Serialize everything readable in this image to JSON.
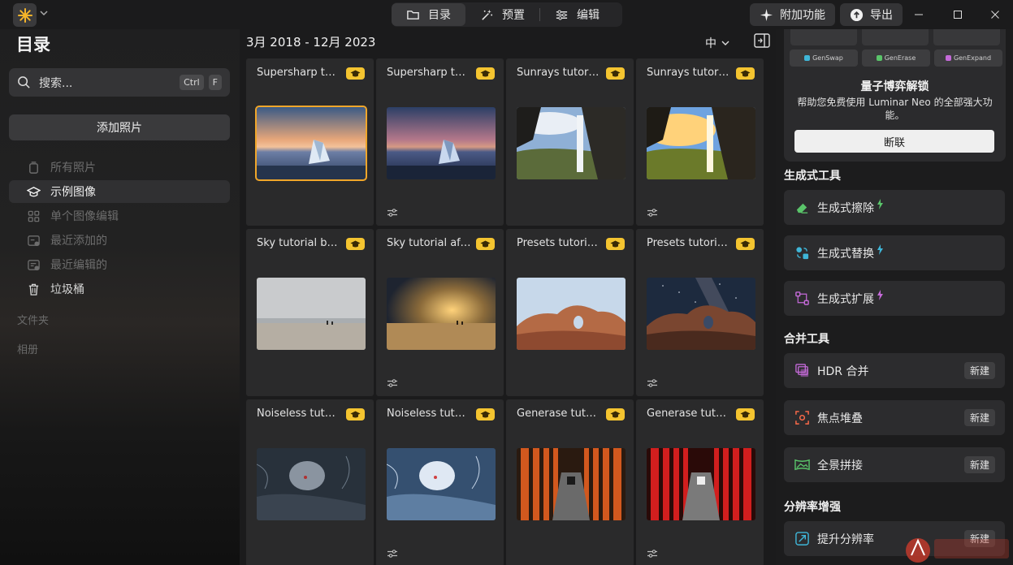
{
  "topbar": {
    "tabs": [
      {
        "label": "目录",
        "icon": "folder-icon",
        "active": true
      },
      {
        "label": "预置",
        "icon": "magic-wand-icon",
        "active": false
      },
      {
        "label": "编辑",
        "icon": "sliders-icon",
        "active": false
      }
    ],
    "extras_label": "附加功能",
    "export_label": "导出"
  },
  "sidebar": {
    "title": "目录",
    "search_placeholder": "搜索...",
    "shortcut_keys": [
      "Ctrl",
      "F"
    ],
    "add_photos_label": "添加照片",
    "items": [
      {
        "label": "所有照片",
        "icon": "photos-stack-icon",
        "state": "disabled"
      },
      {
        "label": "示例图像",
        "icon": "graduation-cap-icon",
        "state": "active"
      },
      {
        "label": "单个图像编辑",
        "icon": "grid-icon",
        "state": "disabled"
      },
      {
        "label": "最近添加的",
        "icon": "recently-added-icon",
        "state": "disabled"
      },
      {
        "label": "最近编辑的",
        "icon": "recently-edited-icon",
        "state": "disabled"
      },
      {
        "label": "垃圾桶",
        "icon": "trash-icon",
        "state": "normal"
      }
    ],
    "sections": [
      "文件夹",
      "相册"
    ]
  },
  "gallery": {
    "date_range": "3月 2018 - 12月 2023",
    "thumb_size": "中",
    "cards": [
      {
        "name": "Supersharp tutorial before",
        "scene": "ice-sunset",
        "selected": true,
        "has_adjust": false
      },
      {
        "name": "Supersharp tutorial after",
        "scene": "ice-sunset-dark",
        "selected": false,
        "has_adjust": true
      },
      {
        "name": "Sunrays tutorial before",
        "scene": "waterfall",
        "selected": false,
        "has_adjust": false
      },
      {
        "name": "Sunrays tutorial after",
        "scene": "waterfall-warm",
        "selected": false,
        "has_adjust": true
      },
      {
        "name": "Sky tutorial before",
        "scene": "beach-grey",
        "selected": false,
        "has_adjust": false
      },
      {
        "name": "Sky tutorial after",
        "scene": "beach-golden",
        "selected": false,
        "has_adjust": true
      },
      {
        "name": "Presets tutorial before",
        "scene": "arch-day",
        "selected": false,
        "has_adjust": false
      },
      {
        "name": "Presets tutorial after",
        "scene": "arch-night",
        "selected": false,
        "has_adjust": true
      },
      {
        "name": "Noiseless tutorial before",
        "scene": "ice-cave-dark",
        "selected": false,
        "has_adjust": false
      },
      {
        "name": "Noiseless tutorial after",
        "scene": "ice-cave-bright",
        "selected": false,
        "has_adjust": true
      },
      {
        "name": "Generase tutorial before",
        "scene": "torii-orange",
        "selected": false,
        "has_adjust": false
      },
      {
        "name": "Generase tutorial after",
        "scene": "torii-red",
        "selected": false,
        "has_adjust": true
      }
    ]
  },
  "right_panel": {
    "chips": [
      {
        "label": "GenSwap",
        "color": "#3fb6d8"
      },
      {
        "label": "GenErase",
        "color": "#5ac46a"
      },
      {
        "label": "GenExpand",
        "color": "#c46ad8"
      }
    ],
    "promo_title": "量子博弈解锁",
    "promo_desc": "帮助您免费使用 Luminar Neo 的全部强大功能。",
    "promo_button": "断联",
    "generative_heading": "生成式工具",
    "generative_tools": [
      {
        "label": "生成式擦除",
        "icon": "eraser-icon",
        "color": "#5ac46a"
      },
      {
        "label": "生成式替换",
        "icon": "swap-icon",
        "color": "#3fb6d8"
      },
      {
        "label": "生成式扩展",
        "icon": "expand-icon",
        "color": "#c46ad8"
      }
    ],
    "merge_heading": "合并工具",
    "merge_tools": [
      {
        "label": "HDR 合并",
        "icon": "hdr-layers-icon",
        "color": "#c46ad8",
        "badge": "新建"
      },
      {
        "label": "焦点堆叠",
        "icon": "focus-stack-icon",
        "color": "#ff6b4a",
        "badge": "新建"
      },
      {
        "label": "全景拼接",
        "icon": "panorama-icon",
        "color": "#5ac46a",
        "badge": "新建"
      }
    ],
    "resolution_heading": "分辨率增强",
    "resolution_tools": [
      {
        "label": "提升分辨率",
        "icon": "upscale-icon",
        "color": "#3fb6d8",
        "badge": "新建"
      }
    ]
  },
  "colors": {
    "accent": "#f0a62a",
    "badge": "#f4c430"
  }
}
